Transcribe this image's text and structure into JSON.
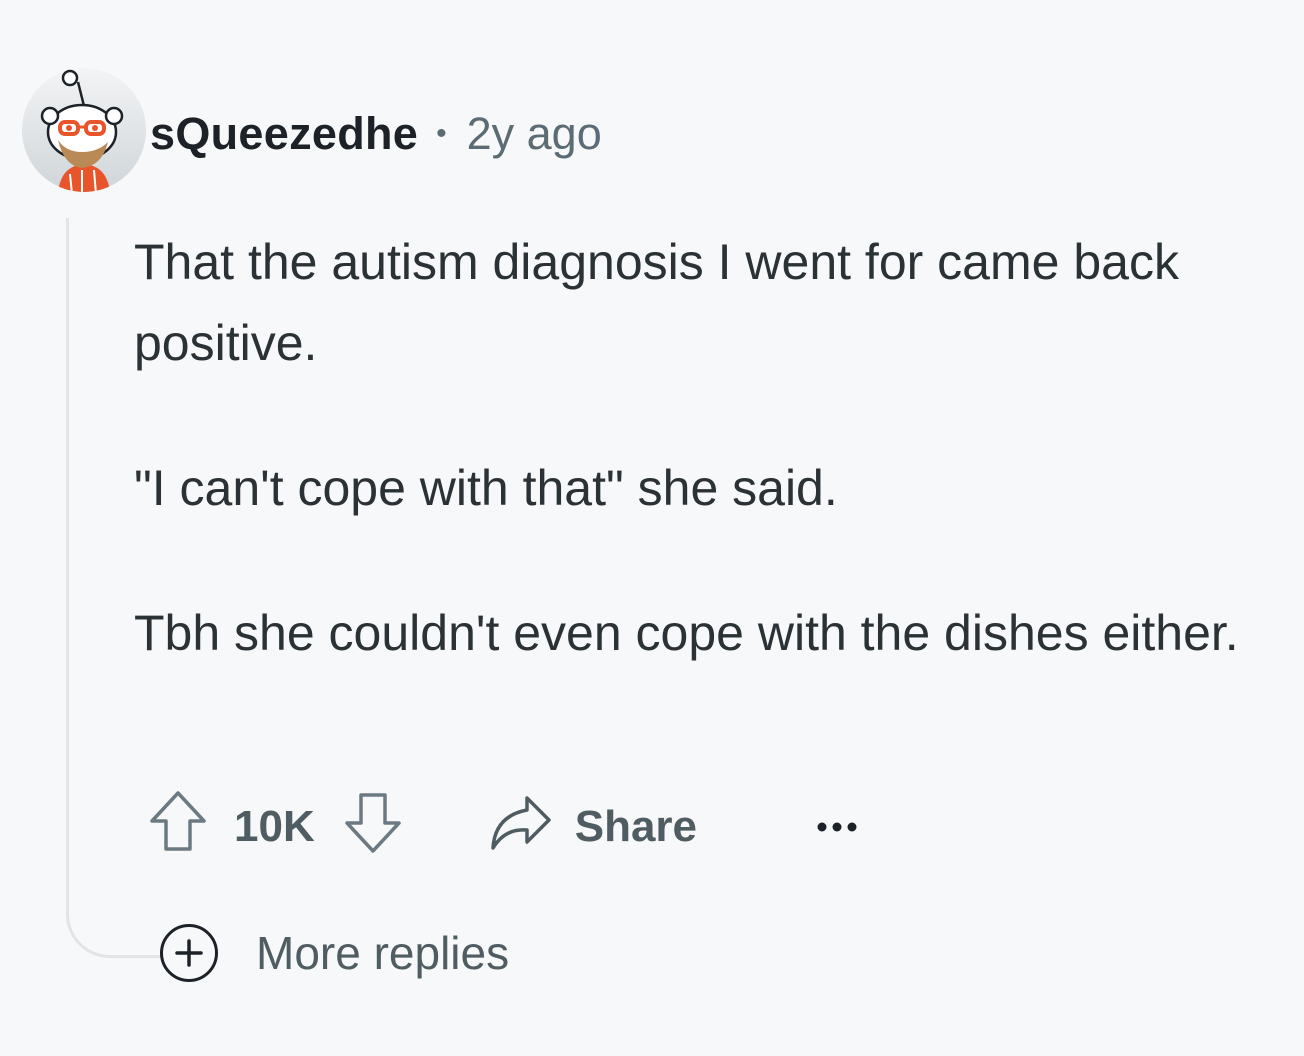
{
  "comment": {
    "username": "sQueezedhe",
    "separator": "•",
    "timestamp": "2y ago",
    "paragraphs": [
      "That the autism diagnosis I went for came back positive.",
      "\"I can't cope with that\" she said.",
      "Tbh she couldn't even cope with the dishes either."
    ]
  },
  "actions": {
    "vote_count": "10K",
    "share_label": "Share",
    "upvote_icon": "arrow-up-icon",
    "downvote_icon": "arrow-down-icon",
    "share_icon": "share-arrow-icon",
    "more_icon": "more-horizontal-icon"
  },
  "replies": {
    "label": "More replies",
    "icon": "plus-circle-icon"
  },
  "colors": {
    "background": "#f7f8fa",
    "text_primary": "#1c2227",
    "text_secondary": "#5c6c74",
    "thread_line": "#e1e5e8"
  }
}
